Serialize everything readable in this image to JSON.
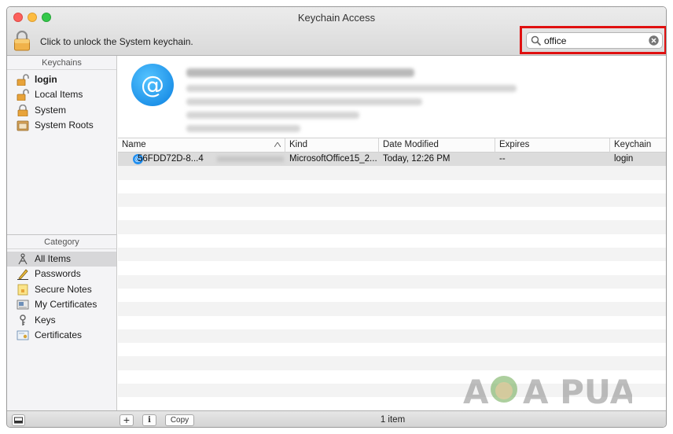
{
  "window": {
    "title": "Keychain Access"
  },
  "toolbar": {
    "unlock_text": "Click to unlock the System keychain.",
    "search_value": "office"
  },
  "sidebar": {
    "keychains_header": "Keychains",
    "keychains": [
      {
        "label": "login",
        "icon": "unlocked-padlock-icon"
      },
      {
        "label": "Local Items",
        "icon": "unlocked-padlock-icon"
      },
      {
        "label": "System",
        "icon": "locked-padlock-icon"
      },
      {
        "label": "System Roots",
        "icon": "cabinet-icon"
      }
    ],
    "category_header": "Category",
    "categories": [
      {
        "label": "All Items",
        "icon": "all-items-icon",
        "selected": true
      },
      {
        "label": "Passwords",
        "icon": "pen-icon"
      },
      {
        "label": "Secure Notes",
        "icon": "note-icon"
      },
      {
        "label": "My Certificates",
        "icon": "certificate-icon"
      },
      {
        "label": "Keys",
        "icon": "key-icon"
      },
      {
        "label": "Certificates",
        "icon": "certificate-icon"
      }
    ]
  },
  "table": {
    "columns": [
      "Name",
      "Kind",
      "Date Modified",
      "Expires",
      "Keychain"
    ],
    "rows": [
      {
        "name": "56FDD72D-8...4",
        "kind": "MicrosoftOffice15_2...",
        "date_modified": "Today, 12:26 PM",
        "expires": "--",
        "keychain": "login"
      }
    ]
  },
  "bottombar": {
    "copy_label": "Copy",
    "add_label": "+",
    "info_label": "i",
    "item_count": "1 item"
  },
  "watermark": {
    "text": "A PUALS"
  },
  "colors": {
    "highlight": "#e01010",
    "accent": "#1e8ef0"
  }
}
